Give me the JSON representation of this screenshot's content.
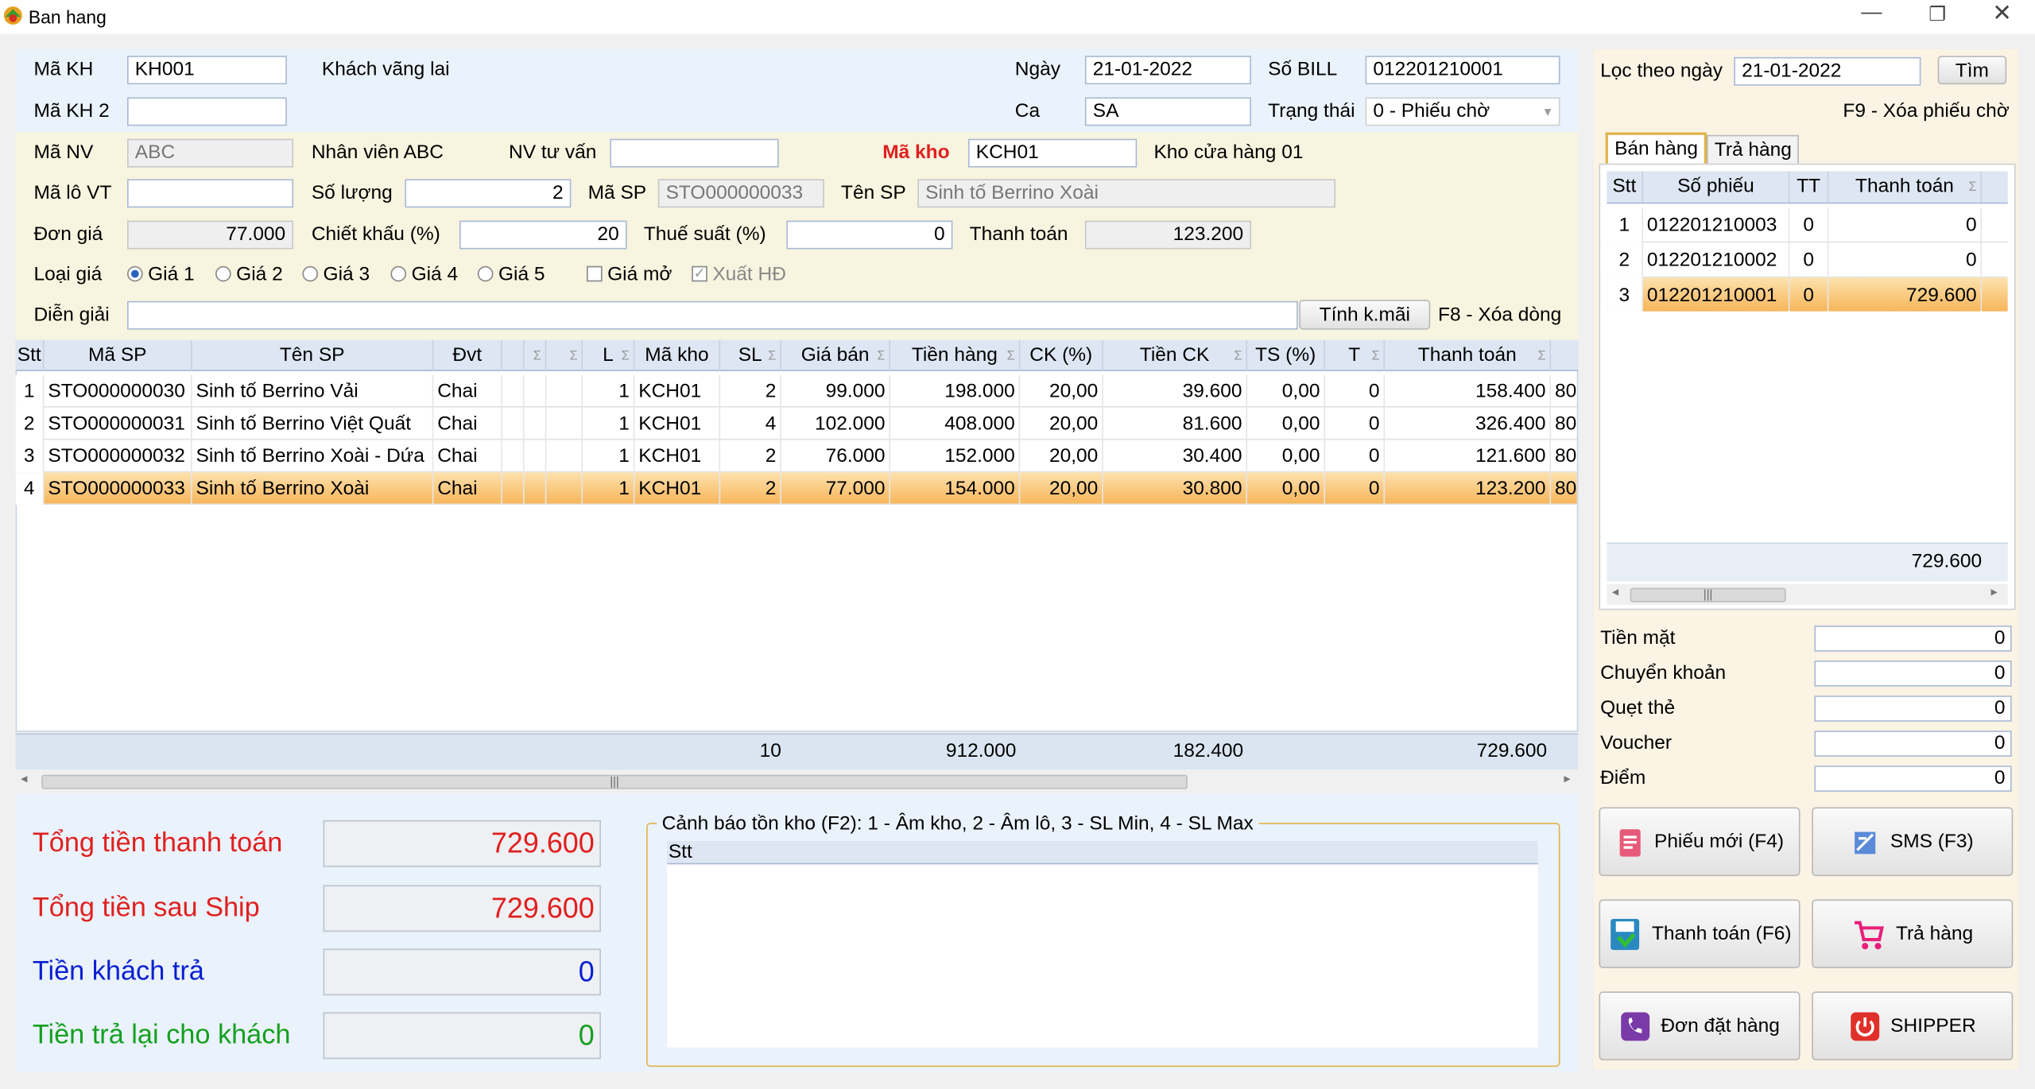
{
  "window": {
    "title": "Ban hang"
  },
  "header": {
    "ma_kh_label": "Mã KH",
    "ma_kh": "KH001",
    "kh_name": "Khách vãng lai",
    "ma_kh2_label": "Mã KH 2",
    "ma_kh2": "",
    "ngay_label": "Ngày",
    "ngay": "21-01-2022",
    "so_bill_label": "Số BILL",
    "so_bill": "012201210001",
    "ca_label": "Ca",
    "ca": "SA",
    "trang_thai_label": "Trạng thái",
    "trang_thai": "0 - Phiếu chờ",
    "ma_nv_label": "Mã NV",
    "ma_nv": "ABC",
    "nv_name": "Nhân viên ABC",
    "nv_tu_van_label": "NV tư vấn",
    "nv_tu_van": "",
    "ma_kho_label": "Mã kho",
    "ma_kho": "KCH01",
    "kho_name": "Kho cửa hàng 01",
    "ma_lo_vt_label": "Mã lô VT",
    "ma_lo_vt": "",
    "so_luong_label": "Số lượng",
    "so_luong": "2",
    "ma_sp_label": "Mã SP",
    "ma_sp": "STO000000033",
    "ten_sp_label": "Tên SP",
    "ten_sp": "Sinh tố Berrino Xoài",
    "don_gia_label": "Đơn giá",
    "don_gia": "77.000",
    "chiet_khau_label": "Chiết khấu (%)",
    "chiet_khau": "20",
    "thue_suat_label": "Thuế suất (%)",
    "thue_suat": "0",
    "thanh_toan_label": "Thanh toán",
    "thanh_toan": "123.200",
    "loai_gia_label": "Loại giá",
    "gia_options": [
      "Giá 1",
      "Giá 2",
      "Giá 3",
      "Giá 4",
      "Giá 5"
    ],
    "gia_mo_label": "Giá mở",
    "xuat_hd_label": "Xuất HĐ",
    "dien_giai_label": "Diễn giải",
    "dien_giai": "",
    "tinh_kmai_label": "Tính k.mãi",
    "f8_label": "F8 - Xóa dòng"
  },
  "grid": {
    "columns": [
      "Stt",
      "Mã SP",
      "Tên SP",
      "Đvt",
      "",
      "",
      "",
      "L",
      "Mã kho",
      "SL",
      "Giá bán",
      "Tiền hàng",
      "CK (%)",
      "Tiền CK",
      "TS (%)",
      "T",
      "Thanh toán"
    ],
    "rows": [
      [
        "1",
        "STO000000030",
        "Sinh tố Berrino Vải",
        "Chai",
        "",
        "",
        "",
        "1",
        "KCH01",
        "2",
        "99.000",
        "198.000",
        "20,00",
        "39.600",
        "0,00",
        "0",
        "158.400",
        "80"
      ],
      [
        "2",
        "STO000000031",
        "Sinh tố Berrino Việt Quất",
        "Chai",
        "",
        "",
        "",
        "1",
        "KCH01",
        "4",
        "102.000",
        "408.000",
        "20,00",
        "81.600",
        "0,00",
        "0",
        "326.400",
        "80"
      ],
      [
        "3",
        "STO000000032",
        "Sinh tố Berrino Xoài - Dứa",
        "Chai",
        "",
        "",
        "",
        "1",
        "KCH01",
        "2",
        "76.000",
        "152.000",
        "20,00",
        "30.400",
        "0,00",
        "0",
        "121.600",
        "80"
      ],
      [
        "4",
        "STO000000033",
        "Sinh tố Berrino Xoài",
        "Chai",
        "",
        "",
        "",
        "1",
        "KCH01",
        "2",
        "77.000",
        "154.000",
        "20,00",
        "30.800",
        "0,00",
        "0",
        "123.200",
        "80"
      ]
    ],
    "totals": {
      "sl": "10",
      "tien_hang": "912.000",
      "tien_ck": "182.400",
      "thanh_toan": "729.600"
    }
  },
  "summary": {
    "tong_tt_label": "Tổng tiền thanh toán",
    "tong_tt": "729.600",
    "tong_ship_label": "Tổng tiền sau Ship",
    "tong_ship": "729.600",
    "khach_tra_label": "Tiền khách trả",
    "khach_tra": "0",
    "tra_lai_label": "Tiền trả lại cho khách",
    "tra_lai": "0"
  },
  "warning": {
    "title": "Cảnh báo tồn kho (F2): 1 - Âm kho, 2 - Âm lô, 3 - SL Min, 4 - SL Max",
    "col": "Stt"
  },
  "right": {
    "loc_label": "Lọc theo ngày",
    "loc_date": "21-01-2022",
    "tim_label": "Tìm",
    "f9_label": "F9 - Xóa phiếu chờ",
    "tabs": [
      "Bán hàng",
      "Trả hàng"
    ],
    "columns": [
      "Stt",
      "Số phiếu",
      "TT",
      "Thanh toán"
    ],
    "rows": [
      [
        "1",
        "012201210003",
        "0",
        "0"
      ],
      [
        "2",
        "012201210002",
        "0",
        "0"
      ],
      [
        "3",
        "012201210001",
        "0",
        "729.600"
      ]
    ],
    "total": "729.600",
    "payments": [
      {
        "label": "Tiền mặt",
        "value": "0"
      },
      {
        "label": "Chuyển khoản",
        "value": "0"
      },
      {
        "label": "Quẹt thẻ",
        "value": "0"
      },
      {
        "label": "Voucher",
        "value": "0"
      },
      {
        "label": "Điểm",
        "value": "0"
      }
    ],
    "buttons": {
      "phieu_moi": "Phiếu mới (F4)",
      "sms": "SMS (F3)",
      "thanh_toan": "Thanh toán (F6)",
      "tra_hang": "Trả hàng",
      "don_dat_hang": "Đơn đặt hàng",
      "shipper": "SHIPPER"
    }
  },
  "colors": {
    "accent_red": "#e0201f",
    "blue": "#0a1fd0",
    "green": "#14a020",
    "selection": "#f7b65a"
  }
}
